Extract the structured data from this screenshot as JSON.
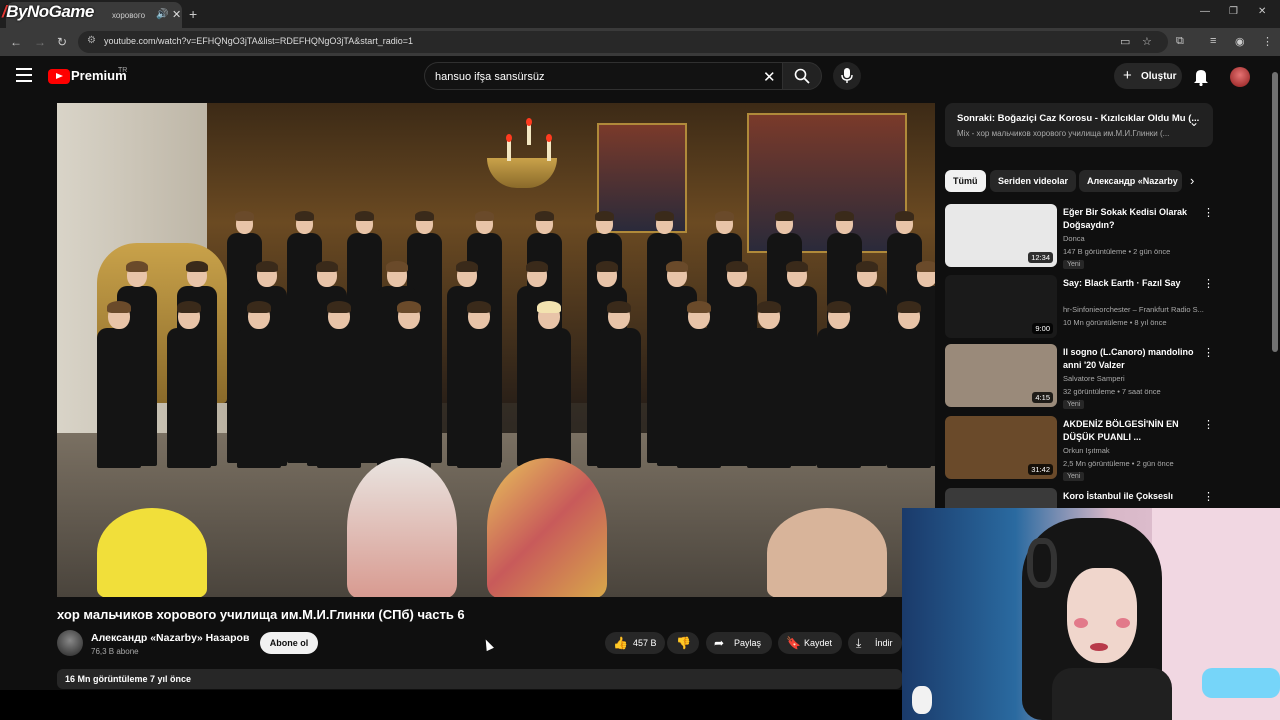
{
  "browser": {
    "brand": "ByNoGame",
    "tab_title": "хорового",
    "tab_sound": "🔊",
    "tab_close": "✕",
    "new_tab": "+",
    "url": "youtube.com/watch?v=EFHQNgO3jTA&list=RDEFHQNgO3jTA&start_radio=1",
    "window_minimize": "—",
    "window_maximize": "❐",
    "window_close": "✕"
  },
  "header": {
    "logo_text": "Premium",
    "logo_region": "TR",
    "search_query": "hansuo ifşa sansürsüz",
    "create_label": "Oluştur"
  },
  "video": {
    "title": "хор мальчиков хорового училища им.М.И.Глинки (СПб) часть 6",
    "channel_name": "Александр «Nazarby» Назаров",
    "channel_subs": "76,3 B abone",
    "subscribe_label": "Abone ol",
    "likes": "457 B",
    "share_label": "Paylaş",
    "save_label": "Kaydet",
    "download_label": "İndir",
    "meta": "16 Mn görüntüleme  7 yıl önce"
  },
  "up_next": {
    "line1": "Sonraki: Boğaziçi Caz Korosu - Kızılcıklar Oldu Mu (...",
    "line2": "Mix - хор мальчиков хорового училища им.М.И.Глинки (..."
  },
  "chips": [
    "Tümü",
    "Seriden videolar",
    "Александр «Nazarby"
  ],
  "recommendations": [
    {
      "title": "Eğer Bir Sokak Kedisi Olarak Doğsaydın?",
      "channel": "Donca",
      "stats": "147 B görüntüleme • 2 gün önce",
      "badge": "Yeni",
      "duration": "12:34",
      "thumb_color": "#e8e8e8"
    },
    {
      "title": "Say: Black Earth · Fazıl Say",
      "channel": "hr-Sinfonieorchester – Frankfurt Radio S...",
      "stats": "10 Mn görüntüleme • 8 yıl önce",
      "badge": "",
      "duration": "9:00",
      "thumb_color": "#1a1a1a"
    },
    {
      "title": "Il sogno  (L.Canoro) mandolino anni '20 Valzer",
      "channel": "Salvatore Samperi",
      "stats": "32 görüntüleme • 7 saat önce",
      "badge": "Yeni",
      "duration": "4:15",
      "thumb_color": "#9a8a7a"
    },
    {
      "title": "AKDENİZ BÖLGESİ'NİN EN DÜŞÜK PUANLI ...",
      "channel": "Orkun Işıtmak",
      "stats": "2,5 Mn görüntüleme • 2 gün önce",
      "badge": "Yeni",
      "duration": "31:42",
      "thumb_color": "#6a4a2a"
    },
    {
      "title": "Koro İstanbul ile  Çokseslı",
      "channel": "",
      "stats": "",
      "badge": "",
      "duration": "",
      "thumb_color": "#3a3a3a"
    }
  ]
}
